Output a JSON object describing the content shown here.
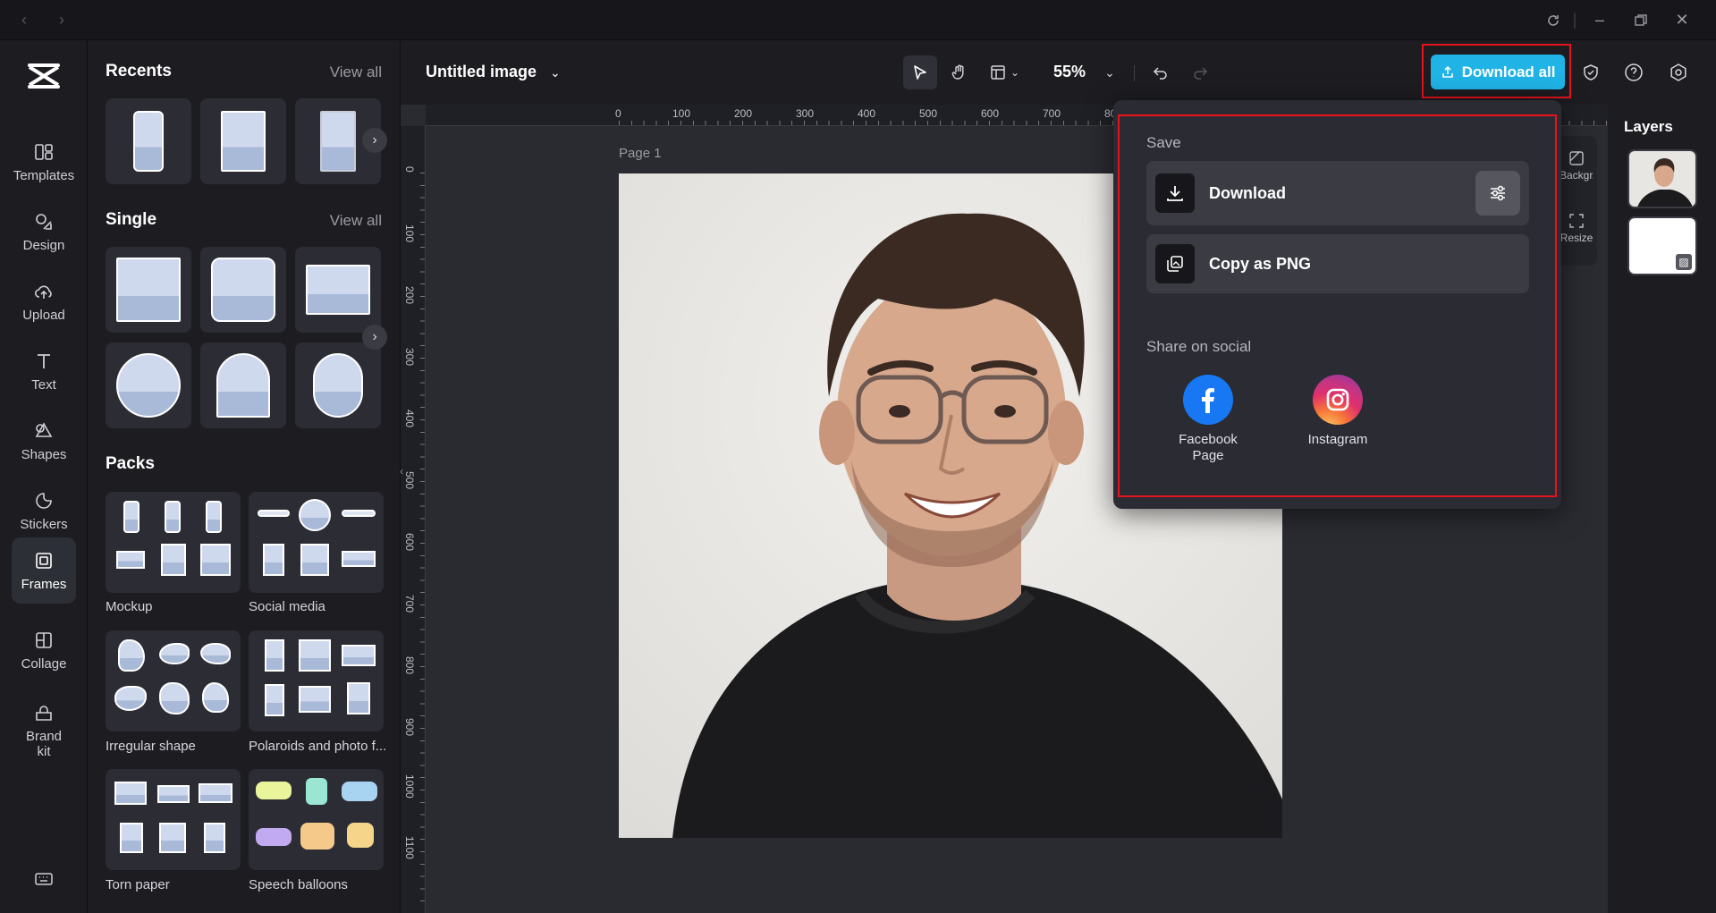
{
  "app": {
    "colors": {
      "accent": "#1fb3e6",
      "highlight": "#e8121b"
    }
  },
  "rail": {
    "items": [
      {
        "label": "Templates",
        "icon": "templates-icon"
      },
      {
        "label": "Design",
        "icon": "design-icon"
      },
      {
        "label": "Upload",
        "icon": "upload-icon"
      },
      {
        "label": "Text",
        "icon": "text-icon"
      },
      {
        "label": "Shapes",
        "icon": "shapes-icon"
      },
      {
        "label": "Stickers",
        "icon": "stickers-icon"
      },
      {
        "label": "Frames",
        "icon": "frames-icon",
        "active": true
      },
      {
        "label": "Collage",
        "icon": "collage-icon"
      },
      {
        "label": "Brand kit",
        "icon": "brand-kit-icon"
      }
    ]
  },
  "library": {
    "recents_title": "Recents",
    "single_title": "Single",
    "packs_title": "Packs",
    "view_all": "View all",
    "packs": [
      "Mockup",
      "Social media",
      "Irregular shape",
      "Polaroids and photo f...",
      "Torn paper",
      "Speech balloons"
    ]
  },
  "toolbar": {
    "doc_title": "Untitled image",
    "zoom": "55%",
    "download_all": "Download all"
  },
  "ruler": {
    "h": [
      "0",
      "100",
      "200",
      "300",
      "400",
      "500",
      "600",
      "700",
      "80"
    ],
    "v": [
      "0",
      "100",
      "200",
      "300",
      "400",
      "500",
      "600",
      "700",
      "800",
      "900",
      "1000",
      "1100"
    ]
  },
  "canvas": {
    "page_label": "Page 1"
  },
  "side_tools": {
    "bg_label": "Backgr...",
    "resize_label": "Resize"
  },
  "layers": {
    "title": "Layers"
  },
  "export": {
    "save_title": "Save",
    "download": "Download",
    "copy_png": "Copy as PNG",
    "share_title": "Share on social",
    "facebook": "Facebook Page",
    "instagram": "Instagram"
  }
}
